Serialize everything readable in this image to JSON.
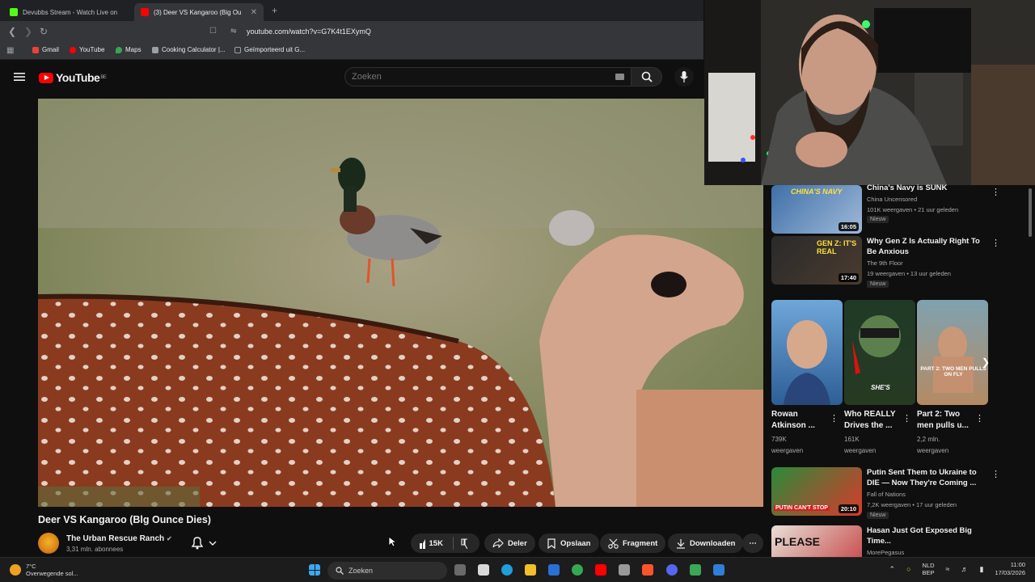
{
  "browser": {
    "tabs": [
      {
        "label": "Devubbs Stream - Watch Live on",
        "favicon_color": "#53fc18",
        "active": false
      },
      {
        "label": "(3) Deer VS Kangaroo (Big Ou",
        "favicon_color": "#ff0000",
        "active": true
      }
    ],
    "new_tab": "+",
    "url": "youtube.com/watch?v=G7K4t1EXymQ",
    "bookmarks": [
      {
        "label": "Gmail",
        "icon_color": "#ea4335"
      },
      {
        "label": "YouTube",
        "icon_color": "#ff0000"
      },
      {
        "label": "Maps",
        "icon_color": "#34a853"
      },
      {
        "label": "Cooking Calculator |...",
        "icon_color": "#9aa0a6"
      },
      {
        "label": "Geïmporteerd uit G...",
        "icon_color": "#9aa0a6"
      }
    ]
  },
  "youtube": {
    "logo_text": "YouTube",
    "logo_region": "BE",
    "search_placeholder": "Zoeken",
    "accent": "#ff0000"
  },
  "video": {
    "title": "Deer VS Kangaroo (Blg Ounce Dies)",
    "channel": "The Urban Rescue Ranch",
    "subscribers": "3,31 mln. abonnees",
    "likes": "15K",
    "actions": {
      "share": "Deler",
      "save": "Opslaan",
      "clip": "Fragment",
      "download": "Downloaden"
    }
  },
  "sidebar": {
    "videos": [
      {
        "title": "China's Navy is SUNK",
        "channel": "China Uncensored",
        "meta": "101K weergaven • 21 uur geleden",
        "badge": "Nieuw",
        "duration": "16:05",
        "thumb_text": "CHINA'S NAVY"
      },
      {
        "title": "Why Gen Z Is Actually Right To Be Anxious",
        "channel": "The 9th Floor",
        "meta": "19 weergaven • 13 uur geleden",
        "badge": "Nieuw",
        "duration": "17:40",
        "thumb_text": "GEN Z: IT'S REAL"
      }
    ],
    "shorts": [
      {
        "title": "Rowan Atkinson ...",
        "views": "739K",
        "views_unit": "weergaven"
      },
      {
        "title": "Who REALLY Drives the ...",
        "views": "161K",
        "views_unit": "weergaven",
        "thumb_text": "SHE'S"
      },
      {
        "title": "Part 2: Two men pulls u...",
        "views": "2,2 mln.",
        "views_unit": "weergaven",
        "thumb_text": "PART 2: TWO MEN PULLS ON FLY"
      }
    ],
    "videos2": [
      {
        "title": "Putin Sent Them to Ukraine to DIE — Now They're Coming ...",
        "channel": "Fall of Nations",
        "meta": "7,2K weergaven • 17 uur geleden",
        "badge": "Nieuw",
        "duration": "20:10",
        "thumb_text": "PUTIN CAN'T STOP"
      },
      {
        "title": "Hasan Just Got Exposed Big Time...",
        "channel": "MorePegasus",
        "thumb_text": "PLEASE"
      }
    ]
  },
  "taskbar": {
    "temperature": "7°C",
    "weather": "Overwegende sol...",
    "search": "Zoeken",
    "lang": "NLD",
    "lang2": "BEP",
    "time": "11:00",
    "date": "17/03/2026"
  }
}
